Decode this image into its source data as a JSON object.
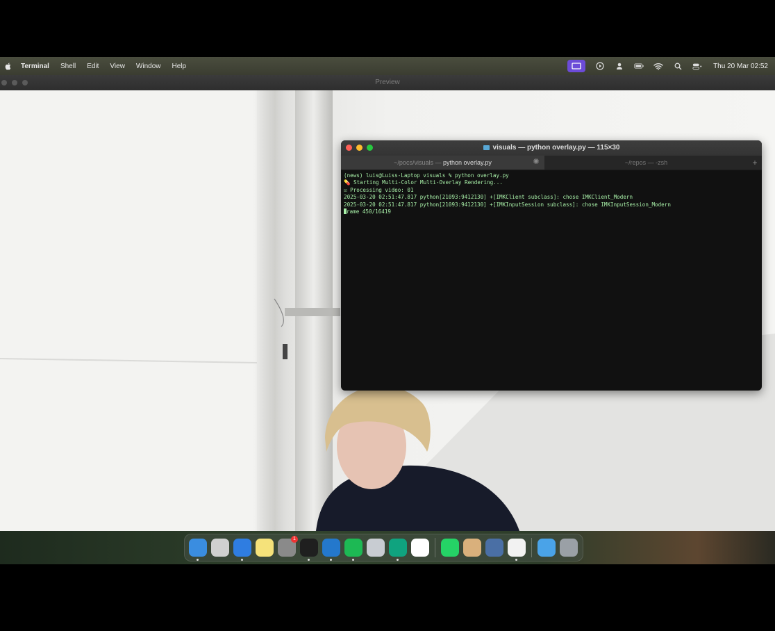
{
  "menubar": {
    "app_name": "Terminal",
    "items": [
      "Shell",
      "Edit",
      "View",
      "Window",
      "Help"
    ],
    "clock": "Thu 20 Mar  02:52"
  },
  "preview_window": {
    "title": "Preview"
  },
  "terminal": {
    "title": "visuals — python overlay.py — 115×30",
    "tabs": [
      {
        "path": "~/pocs/visuals — ",
        "command": "python overlay.py",
        "active": true
      },
      {
        "path": "~/repos — -zsh",
        "command": "",
        "active": false
      }
    ],
    "lines": [
      "(news) luis@Luiss-Laptop visuals % python overlay.py",
      "💊 Starting Multi-Color Multi-Overlay Rendering...",
      "☑ Processing video: 01",
      "2025-03-20 02:51:47.817 python[21093:9412130] +[IMKClient subclass]: chose IMKClient_Modern",
      "2025-03-20 02:51:47.817 python[21093:9412130] +[IMKInputSession subclass]: chose IMKInputSession_Modern"
    ],
    "last_line": "rame 450/16419"
  },
  "dock": {
    "apps": [
      {
        "name": "finder-icon",
        "color": "#3a8de0"
      },
      {
        "name": "launchpad-icon",
        "color": "#d0d0d0"
      },
      {
        "name": "safari-icon",
        "color": "#2f7de1"
      },
      {
        "name": "notes-icon",
        "color": "#f5e27a"
      },
      {
        "name": "system-settings-icon",
        "color": "#8a8a8a",
        "badge": "1"
      },
      {
        "name": "terminal-icon",
        "color": "#1f1f1f"
      },
      {
        "name": "vscode-icon",
        "color": "#2478cc"
      },
      {
        "name": "spotify-icon",
        "color": "#1db954"
      },
      {
        "name": "disk-utility-icon",
        "color": "#c8ccd2"
      },
      {
        "name": "chatgpt-icon",
        "color": "#10a37f"
      },
      {
        "name": "notion-icon",
        "color": "#ffffff"
      },
      {
        "name": "whatsapp-icon",
        "color": "#25d366"
      },
      {
        "name": "archive-utility-icon",
        "color": "#d9b07c"
      },
      {
        "name": "network-radar-icon",
        "color": "#4a6fa5"
      },
      {
        "name": "textedit-document-icon",
        "color": "#f2f2f2"
      },
      {
        "name": "downloads-folder-icon",
        "color": "#4aa3e8"
      },
      {
        "name": "trash-icon",
        "color": "#9aa0a6"
      }
    ]
  }
}
